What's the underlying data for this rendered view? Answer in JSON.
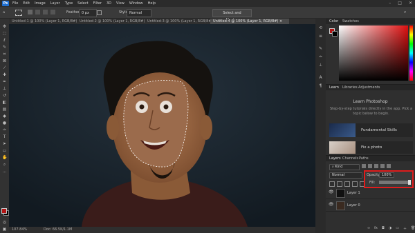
{
  "menubar": {
    "logo": "Ps",
    "items": [
      "File",
      "Edit",
      "Image",
      "Layer",
      "Type",
      "Select",
      "Filter",
      "3D",
      "View",
      "Window",
      "Help"
    ]
  },
  "options": {
    "feather_label": "Feather:",
    "feather_value": "0 px",
    "style_label": "Style:",
    "style_value": "Normal",
    "select_mask_button": "Select and Mask..."
  },
  "tabs": [
    "Untitled-1 @ 100% (Layer 1, RGB/8#)",
    "Untitled-2 @ 100% (Layer 1, RGB/8#)",
    "Untitled-3 @ 100% (Layer 1, RGB/8#)",
    "Untitled-4 @ 100% (Layer 1, RGB/8#)"
  ],
  "status": {
    "zoom": "107.84%",
    "doc": "Doc: 66.5K/1.1M"
  },
  "panels": {
    "color_tabs": [
      "Color",
      "Swatches"
    ],
    "learn_tabs": [
      "Learn",
      "Libraries",
      "Adjustments"
    ],
    "learn_title": "Learn Photoshop",
    "learn_desc_1": "Step-by-step tutorials directly in the app. Pick a",
    "learn_desc_2": "topic below to begin.",
    "cards": [
      "Fundamental Skills",
      "Fix a photo"
    ],
    "layers_tabs": [
      "Layers",
      "Channels",
      "Paths"
    ],
    "kind_label": "Kind",
    "blend_mode": "Normal",
    "opacity_label": "Opacity:",
    "opacity_value": "100%",
    "fill_label": "Fill:",
    "fill_value": "100%",
    "layers": [
      "Layer 1",
      "Layer 0"
    ]
  },
  "colors": {
    "foreground": "#b31414",
    "background": "#000000",
    "highlight": "#e01c1c"
  }
}
